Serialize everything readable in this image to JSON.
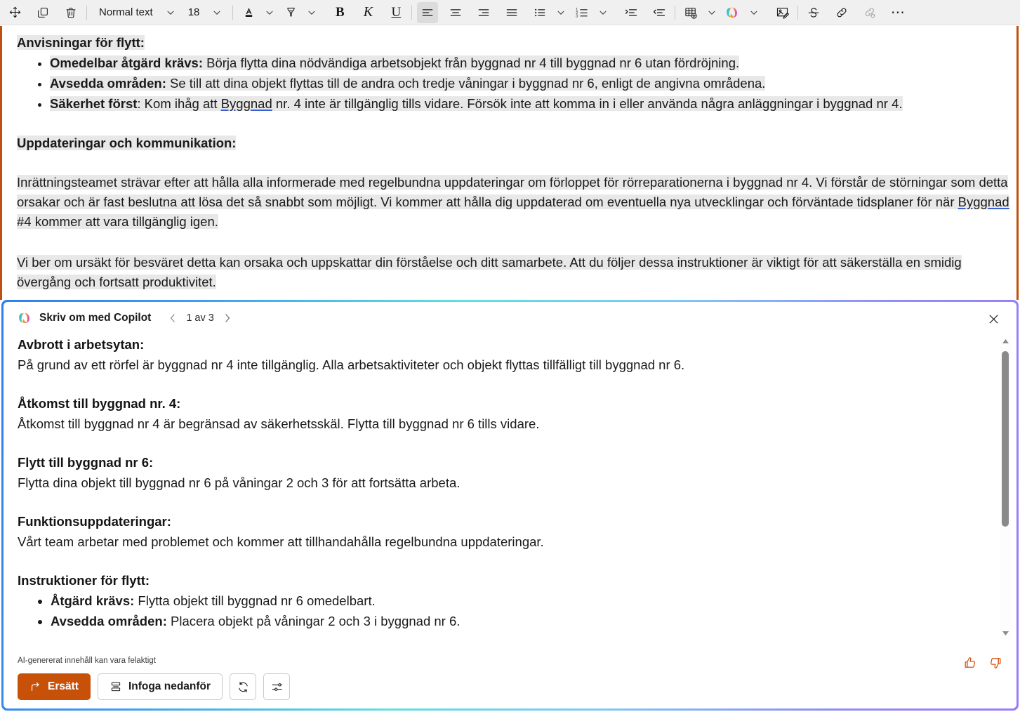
{
  "toolbar": {
    "move_tool": "move-handle",
    "copy_tool": "copy",
    "delete_tool": "delete",
    "style_name": "Normal text",
    "font_size": "18",
    "bold_label": "B",
    "italic_label": "K",
    "underline_label": "U",
    "icons": {
      "move": "move-icon",
      "copy": "copy-icon",
      "delete": "trash-icon",
      "font_color": "font-color-icon",
      "highlight": "highlight-icon",
      "align_left": "align-left-icon",
      "align_center": "align-center-icon",
      "align_right": "align-right-icon",
      "align_justify": "align-justify-icon",
      "bullet_list": "bullet-list-icon",
      "numbered_list": "numbered-list-icon",
      "indent_increase": "indent-increase-icon",
      "indent_decrease": "indent-decrease-icon",
      "insert_table": "insert-table-icon",
      "copilot": "copilot-icon",
      "insert_image": "insert-image-icon",
      "strikethrough": "strikethrough-icon",
      "insert_link": "link-icon",
      "remove_link": "remove-link-icon",
      "more": "more-options-icon"
    }
  },
  "document": {
    "heading1": "Anvisningar för flytt:",
    "bullets1": [
      {
        "bold": "Omedelbar åtgärd krävs:",
        "text": " Börja flytta dina nödvändiga arbetsobjekt från byggnad nr 4 till byggnad nr 6 utan fördröjning."
      },
      {
        "bold": "Avsedda områden:",
        "text": " Se till att dina objekt flyttas till de andra och tredje våningar i byggnad nr 6, enligt de angivna områdena."
      },
      {
        "bold": "Säkerhet först",
        "text_a": ": Kom ihåg att ",
        "link": "Byggnad",
        "text_b": " nr. 4 inte är tillgänglig tills vidare. Försök inte att komma in i eller använda några anläggningar i byggnad nr 4."
      }
    ],
    "heading2": "Uppdateringar och kommunikation:",
    "para1_a": "Inrättningsteamet strävar efter att hålla alla informerade med regelbundna uppdateringar om förloppet för rörreparationerna i byggnad nr 4. Vi förstår de störningar som detta orsakar och är fast beslutna att lösa det så snabbt som möjligt. Vi kommer att hålla dig uppdaterad om eventuella nya utvecklingar och förväntade tidsplaner för när ",
    "para1_link": "Byggnad",
    "para1_b": " #4 kommer att vara tillgänglig igen.",
    "para2": "Vi ber om ursäkt för besväret detta kan orsaka och uppskattar din förståelse och ditt samarbete. Att du följer dessa instruktioner är viktigt för att säkerställa en smidig övergång och fortsatt produktivitet."
  },
  "copilot": {
    "title": "Skriv om med Copilot",
    "counter": "1 av 3",
    "prev_label": "previous",
    "next_label": "next",
    "close_label": "close",
    "blocks": [
      {
        "heading": "Avbrott i arbetsytan:",
        "text": "På grund av ett rörfel är byggnad nr 4 inte tillgänglig. Alla arbetsaktiviteter och objekt flyttas tillfälligt till byggnad nr 6."
      },
      {
        "heading": "Åtkomst till byggnad nr. 4:",
        "text": "Åtkomst till byggnad nr 4 är begränsad av säkerhetsskäl. Flytta till byggnad nr 6 tills vidare."
      },
      {
        "heading": "Flytt till byggnad nr 6:",
        "text": "Flytta dina objekt till byggnad nr 6 på våningar 2 och 3 för att fortsätta arbeta."
      },
      {
        "heading": "Funktionsuppdateringar:",
        "text": "Vårt team arbetar med problemet och kommer att tillhandahålla regelbundna uppdateringar."
      }
    ],
    "last_heading": "Instruktioner för flytt:",
    "last_bullets": [
      {
        "bold": "Åtgärd krävs:",
        "text": " Flytta objekt till byggnad nr 6 omedelbart."
      },
      {
        "bold": "Avsedda områden:",
        "text": " Placera objekt på våningar 2 och 3 i byggnad nr 6."
      }
    ],
    "disclaimer": "AI-genererat innehåll kan vara felaktigt",
    "buttons": {
      "replace": "Ersätt",
      "insert_below": "Infoga nedanför",
      "regenerate": "regenerate",
      "settings": "settings"
    },
    "feedback": {
      "like": "thumbs-up",
      "dislike": "thumbs-down"
    }
  },
  "colors": {
    "accent_orange": "#c75109",
    "doc_edge": "#c0500f",
    "gradient_start": "#2f7ef0",
    "gradient_mid": "#5fe0dd",
    "gradient_end": "#9b7cf8",
    "link_underline": "#3b5fd6",
    "selection_highlight": "#e8e8e8"
  }
}
